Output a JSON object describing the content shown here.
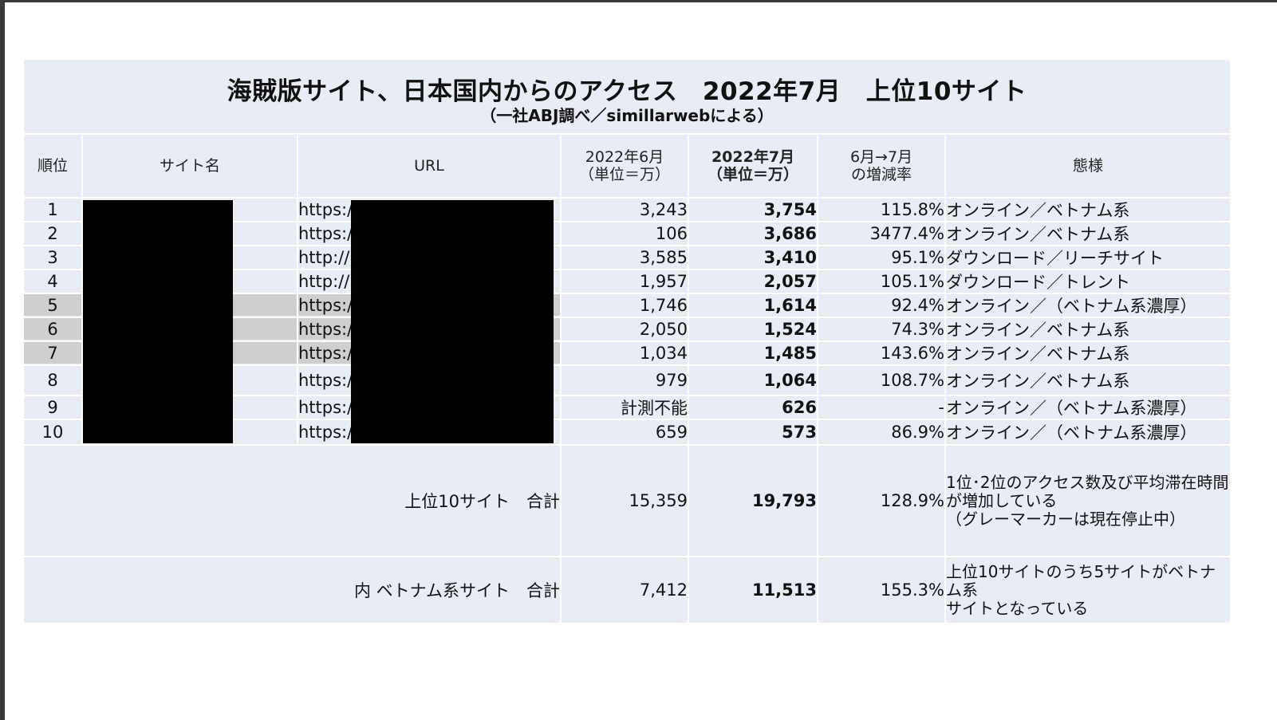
{
  "title": "海賊版サイト、日本国内からのアクセス　2022年7月　上位10サイト",
  "subtitle": "（一社ABJ調べ／simillarwebによる）",
  "headers": {
    "rank": "順位",
    "site": "サイト名",
    "url": "URL",
    "jun_line1": "2022年6月",
    "jun_line2": "（単位＝万）",
    "jul_line1": "2022年7月",
    "jul_line2": "（単位＝万）",
    "rate_line1": "6月→7月",
    "rate_line2": "の増減率",
    "mode": "態様"
  },
  "rows": [
    {
      "rank": "1",
      "url": "https:/",
      "jun": "3,243",
      "jul": "3,754",
      "rate": "115.8%",
      "mode": "オンライン／ベトナム系"
    },
    {
      "rank": "2",
      "url": "https:/",
      "jun": "106",
      "jul": "3,686",
      "rate": "3477.4%",
      "mode": "オンライン／ベトナム系"
    },
    {
      "rank": "3",
      "url": "http://",
      "jun": "3,585",
      "jul": "3,410",
      "rate": "95.1%",
      "mode": "ダウンロード／リーチサイト"
    },
    {
      "rank": "4",
      "url": "http://",
      "jun": "1,957",
      "jul": "2,057",
      "rate": "105.1%",
      "mode": "ダウンロード／トレント"
    },
    {
      "rank": "5",
      "url": "https:/",
      "jun": "1,746",
      "jul": "1,614",
      "rate": "92.4%",
      "mode": "オンライン／（ベトナム系濃厚）"
    },
    {
      "rank": "6",
      "url": "https:/",
      "jun": "2,050",
      "jul": "1,524",
      "rate": "74.3%",
      "mode": "オンライン／ベトナム系"
    },
    {
      "rank": "7",
      "url": "https:/",
      "jun": "1,034",
      "jul": "1,485",
      "rate": "143.6%",
      "mode": "オンライン／ベトナム系"
    },
    {
      "rank": "8",
      "url": "https:/",
      "jun": "979",
      "jul": "1,064",
      "rate": "108.7%",
      "mode": "オンライン／ベトナム系"
    },
    {
      "rank": "9",
      "url": "https:/",
      "jun": "計測不能",
      "jul": "626",
      "rate": "-",
      "mode": "オンライン／（ベトナム系濃厚）"
    },
    {
      "rank": "10",
      "url": "https:/",
      "jun": "659",
      "jul": "573",
      "rate": "86.9%",
      "mode": "オンライン／（ベトナム系濃厚）"
    }
  ],
  "totals": [
    {
      "label": "上位10サイト　合計",
      "jun": "15,359",
      "jul": "19,793",
      "rate": "128.9%",
      "note_lines": [
        "1位･2位のアクセス数及び平均滞在時間",
        "が増加している",
        "（グレーマーカーは現在停止中）"
      ]
    },
    {
      "label": "内 ベトナム系サイト　合計",
      "jun": "7,412",
      "jul": "11,513",
      "rate": "155.3%",
      "note_lines": [
        "上位10サイトのうち5サイトがベトナム系",
        "サイトとなっている"
      ]
    }
  ],
  "colors": {
    "panel": "#e8ecf5",
    "gray_marker": "#d0cece",
    "redaction": "#000000"
  }
}
